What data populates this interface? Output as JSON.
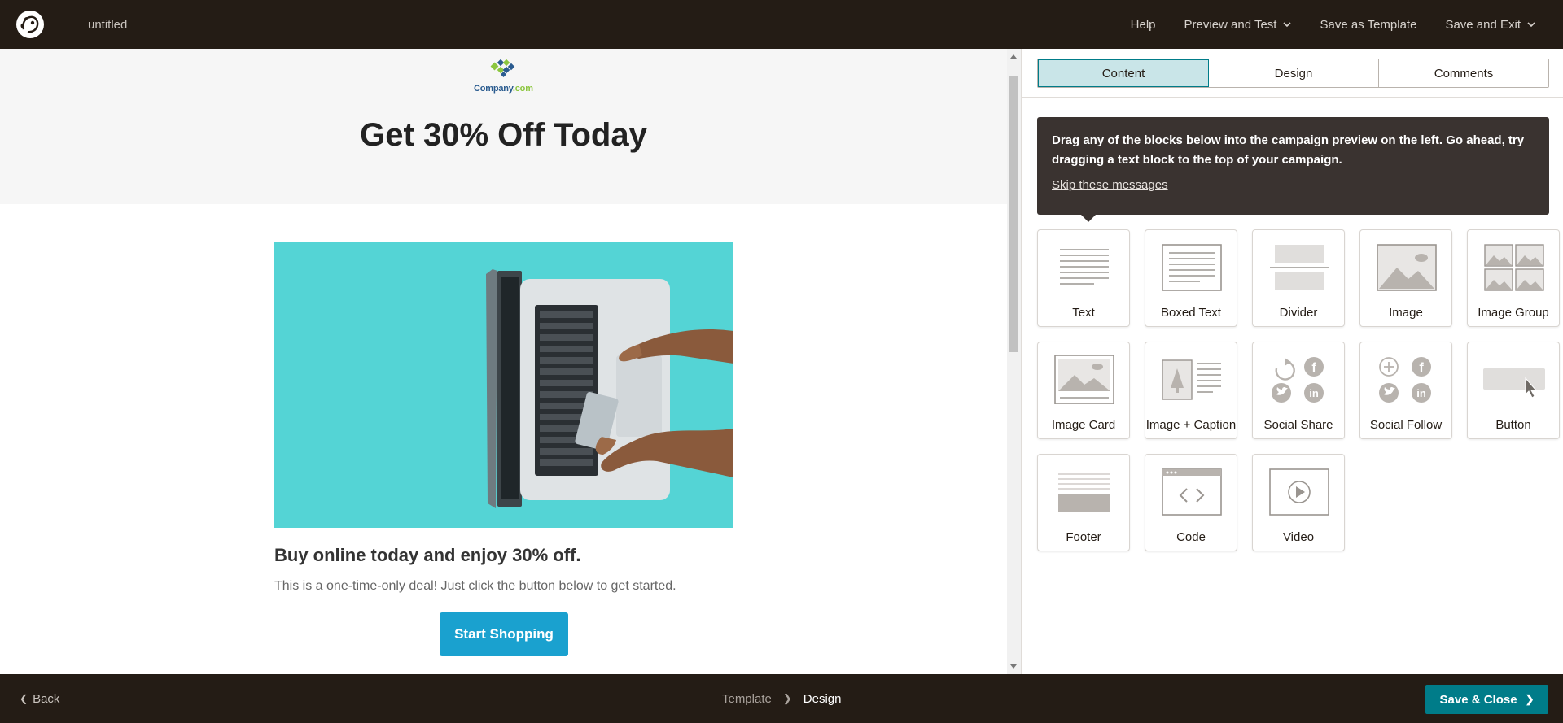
{
  "topbar": {
    "campaign_name": "untitled",
    "nav": [
      {
        "label": "Help"
      },
      {
        "label": "Preview and Test",
        "dropdown": true
      },
      {
        "label": "Save as Template"
      },
      {
        "label": "Save and Exit",
        "dropdown": true
      }
    ]
  },
  "preview": {
    "brand_name": "Company",
    "brand_suffix": ".com",
    "title": "Get 30% Off Today",
    "subheading": "Buy online today and enjoy 30% off.",
    "body": "This is a one-time-only deal! Just click the button below to get started.",
    "cta_label": "Start Shopping"
  },
  "panel": {
    "tabs": [
      {
        "label": "Content",
        "active": true
      },
      {
        "label": "Design",
        "active": false
      },
      {
        "label": "Comments",
        "active": false
      }
    ],
    "tooltip": {
      "text": "Drag any of the blocks below into the campaign preview on the left. Go ahead, try dragging a text block to the top of your campaign.",
      "link": "Skip these messages"
    },
    "blocks": [
      {
        "label": "Text",
        "icon": "text-block-icon"
      },
      {
        "label": "Boxed Text",
        "icon": "boxed-text-block-icon"
      },
      {
        "label": "Divider",
        "icon": "divider-block-icon"
      },
      {
        "label": "Image",
        "icon": "image-block-icon"
      },
      {
        "label": "Image Group",
        "icon": "image-group-block-icon"
      },
      {
        "label": "Image Card",
        "icon": "image-card-block-icon"
      },
      {
        "label": "Image + Caption",
        "icon": "image-caption-block-icon"
      },
      {
        "label": "Social Share",
        "icon": "social-share-block-icon"
      },
      {
        "label": "Social Follow",
        "icon": "social-follow-block-icon"
      },
      {
        "label": "Button",
        "icon": "button-block-icon"
      },
      {
        "label": "Footer",
        "icon": "footer-block-icon"
      },
      {
        "label": "Code",
        "icon": "code-block-icon"
      },
      {
        "label": "Video",
        "icon": "video-block-icon"
      }
    ]
  },
  "bottombar": {
    "back_label": "Back",
    "crumbs": [
      "Template",
      "Design"
    ],
    "save_close_label": "Save & Close"
  },
  "colors": {
    "chrome": "#241c15",
    "accent": "#007c89",
    "cta": "#1aa1cf",
    "active_tab": "#c9e5e8",
    "hero_bg": "#4fd3d4"
  }
}
